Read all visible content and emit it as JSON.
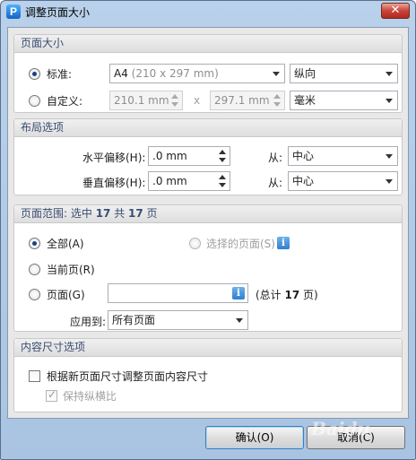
{
  "window": {
    "title": "调整页面大小",
    "close_glyph": "✕",
    "app_icon_glyph": "P"
  },
  "page_size": {
    "header": "页面大小",
    "standard_label": "标准:",
    "standard_selected": true,
    "paper_name": "A4",
    "paper_dims": "(210 x 297 mm)",
    "orientation": "纵向",
    "custom_label": "自定义:",
    "custom_width": "210.1 mm",
    "times": "x",
    "custom_height": "297.1 mm",
    "unit": "毫米"
  },
  "layout": {
    "header": "布局选项",
    "h_offset_label": "水平偏移(H):",
    "h_offset_value": ".0 mm",
    "h_from_label": "从:",
    "h_from_value": "中心",
    "v_offset_label": "垂直偏移(H):",
    "v_offset_value": ".0 mm",
    "v_from_label": "从:",
    "v_from_value": "中心"
  },
  "page_range": {
    "header_prefix": "页面范围: 选中 ",
    "selected_count": "17",
    "header_mid": " 共 ",
    "total_count": "17",
    "header_suffix": " 页",
    "all_label": "全部(A)",
    "all_selected": true,
    "selected_pages_label": "选择的页面(S)",
    "current_label": "当前页(R)",
    "pages_label": "页面(G)",
    "pages_value": "",
    "total_prefix": "(总计 ",
    "total_pages": "17",
    "total_suffix": " 页)",
    "apply_to_label": "应用到:",
    "apply_to_value": "所有页面"
  },
  "content_size": {
    "header": "内容尺寸选项",
    "resize_content_label": "根据新页面尺寸调整页面内容尺寸",
    "resize_content_checked": false,
    "keep_ratio_label": "保持纵横比",
    "keep_ratio_checked": true
  },
  "buttons": {
    "ok": "确认(O)",
    "cancel": "取消(C)"
  },
  "watermark": "Baidu"
}
